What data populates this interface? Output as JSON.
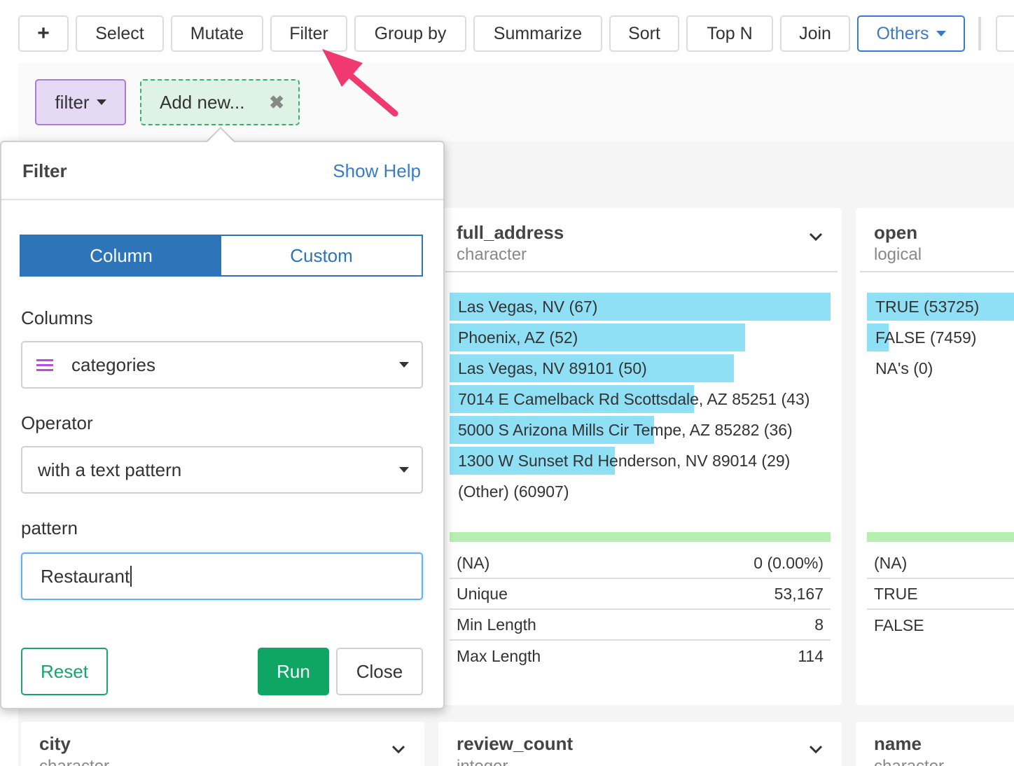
{
  "toolbar": {
    "add_label": "+",
    "buttons": [
      "Select",
      "Mutate",
      "Filter",
      "Group by",
      "Summarize",
      "Sort",
      "Top N",
      "Join"
    ],
    "others_label": "Others"
  },
  "steps": {
    "filter_label": "filter",
    "add_new_label": "Add new...",
    "remove_glyph": "✖"
  },
  "popover": {
    "title": "Filter",
    "help_link": "Show Help",
    "tabs": {
      "column": "Column",
      "custom": "Custom"
    },
    "columns_label": "Columns",
    "columns_value": "categories",
    "operator_label": "Operator",
    "operator_value": "with a text pattern",
    "pattern_label": "pattern",
    "pattern_value": "Restaurant",
    "reset_label": "Reset",
    "run_label": "Run",
    "close_label": "Close"
  },
  "cards": {
    "full_address": {
      "name": "full_address",
      "type": "character",
      "bars": [
        {
          "label": "Las Vegas, NV (67)",
          "fraction": 1.0
        },
        {
          "label": "Phoenix, AZ (52)",
          "fraction": 0.776
        },
        {
          "label": "Las Vegas, NV 89101 (50)",
          "fraction": 0.746
        },
        {
          "label": "7014 E Camelback Rd Scottsdale, AZ 85251 (43)",
          "fraction": 0.642
        },
        {
          "label": "5000 S Arizona Mills Cir Tempe, AZ 85282 (36)",
          "fraction": 0.537
        },
        {
          "label": "1300 W Sunset Rd Henderson, NV 89014 (29)",
          "fraction": 0.433
        },
        {
          "label": "(Other) (60907)",
          "fraction": 0
        }
      ],
      "stats": [
        {
          "key": "(NA)",
          "value": "0 (0.00%)"
        },
        {
          "key": "Unique",
          "value": "53,167"
        },
        {
          "key": "Min Length",
          "value": "8"
        },
        {
          "key": "Max Length",
          "value": "114"
        }
      ]
    },
    "open": {
      "name": "open",
      "type": "logical",
      "bars": [
        {
          "label": "TRUE (53725)",
          "fraction": 1.0
        },
        {
          "label": "FALSE (7459)",
          "fraction": 0.139
        },
        {
          "label": "NA's (0)",
          "fraction": 0
        }
      ],
      "stats": [
        {
          "key": "(NA)",
          "value": ""
        },
        {
          "key": "TRUE",
          "value": ""
        },
        {
          "key": "FALSE",
          "value": ""
        }
      ]
    },
    "city": {
      "name": "city",
      "type": "character"
    },
    "review_count": {
      "name": "review_count",
      "type": "integer"
    },
    "name": {
      "name": "name",
      "type": "character"
    }
  },
  "colors": {
    "accent_blue": "#2e74b8",
    "bar_fill": "#8fe0f5",
    "na_bar": "#b7efb0",
    "run_green": "#0ea662",
    "filter_step_bg": "#e6d9f5",
    "annotation_arrow": "#f0396f"
  }
}
